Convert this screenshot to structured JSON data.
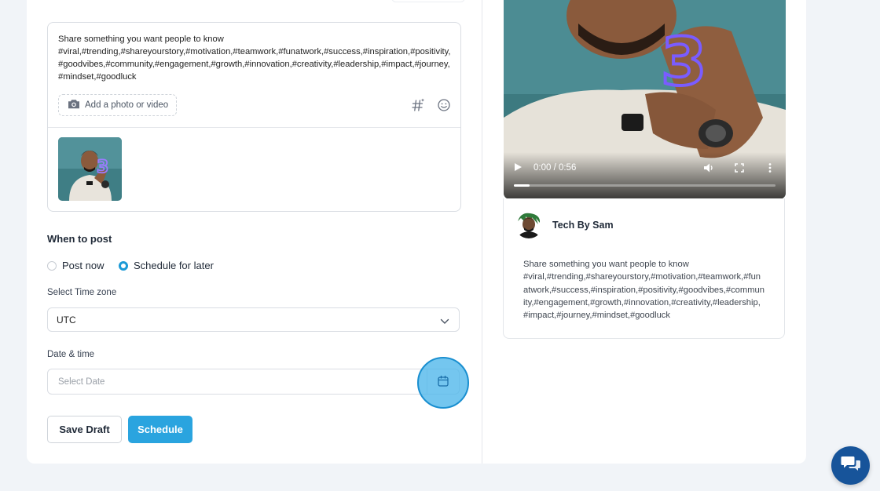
{
  "composer": {
    "text_line": "Share something you want people to know",
    "hashtags": "#viral,#trending,#shareyourstory,#motivation,#teamwork,#funatwork,#success,#inspiration,#positivity,#goodvibes,#community,#engagement,#growth,#innovation,#creativity,#leadership,#impact,#journey,#mindset,#goodluck",
    "add_media_label": "Add a photo or video",
    "hashtag_icon": "hashtag-ai-icon",
    "emoji_icon": "emoji-icon",
    "attachment": {
      "overlay_digit": "3"
    }
  },
  "schedule": {
    "title": "When to post",
    "options": [
      {
        "label": "Post now",
        "selected": false
      },
      {
        "label": "Schedule for later",
        "selected": true
      }
    ],
    "timezone_label": "Select Time zone",
    "timezone_value": "UTC",
    "datetime_label": "Date & time",
    "date_placeholder": "Select Date",
    "save_draft_label": "Save Draft",
    "schedule_label": "Schedule"
  },
  "preview": {
    "video": {
      "overlay_digit": "3",
      "time_display": "0:00 / 0:56",
      "progress_fraction": 0.06
    },
    "account_name": "Tech By Sam",
    "text_line": "Share something you want people to know",
    "hashtags": "#viral,#trending,#shareyourstory,#motivation,#teamwork,#funatwork,#success,#inspiration,#positivity,#goodvibes,#community,#engagement,#growth,#innovation,#creativity,#leadership,#impact,#journey,#mindset,#goodluck"
  },
  "colors": {
    "accent": "#2aa4df",
    "radio_selected": "#1c9ad6",
    "chat_button": "#17549a",
    "page_bg": "#f1f4f8"
  },
  "chat": {
    "icon": "chat-bubbles-icon"
  }
}
